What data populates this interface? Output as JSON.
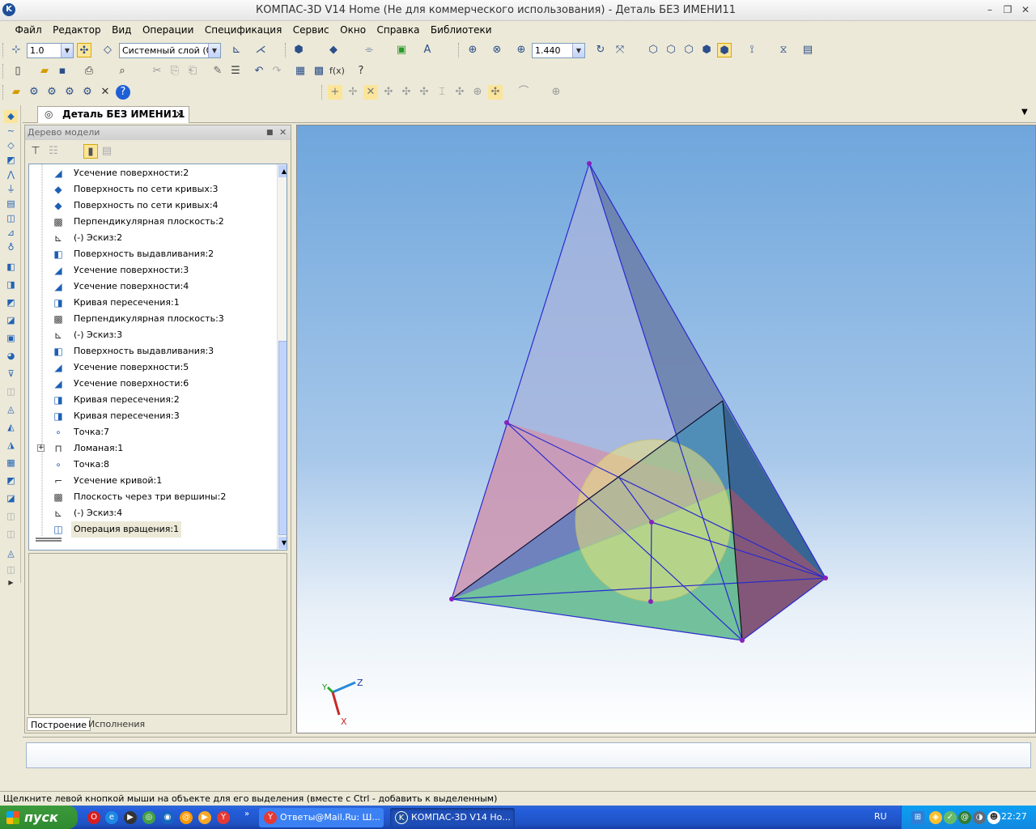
{
  "window": {
    "title": "КОМПАС-3D V14 Home (Не для коммерческого использования) - Деталь БЕЗ ИМЕНИ11",
    "app_icon": "kompas-logo-icon",
    "minimize": "–",
    "restore": "❐",
    "close": "✕"
  },
  "menu": [
    "Файл",
    "Редактор",
    "Вид",
    "Операции",
    "Спецификация",
    "Сервис",
    "Окно",
    "Справка",
    "Библиотеки"
  ],
  "toolbar1": {
    "step_value": "1.0",
    "layer_value": "Системный слой (0)",
    "zoom_value": "1.440"
  },
  "document_tab": {
    "label": "Деталь БЕЗ ИМЕНИ11",
    "close": "✕"
  },
  "tree": {
    "title": "Дерево модели",
    "pin": "■",
    "close": "✕",
    "items": [
      {
        "label": "Усечение поверхности:2",
        "icon": "surface-trim-icon"
      },
      {
        "label": "Поверхность по сети кривых:3",
        "icon": "curve-mesh-surface-icon"
      },
      {
        "label": "Поверхность по сети кривых:4",
        "icon": "curve-mesh-surface-icon"
      },
      {
        "label": "Перпендикулярная плоскость:2",
        "icon": "plane-icon"
      },
      {
        "label": "(-) Эскиз:2",
        "icon": "sketch-icon"
      },
      {
        "label": "Поверхность выдавливания:2",
        "icon": "extrude-surface-icon"
      },
      {
        "label": "Усечение поверхности:3",
        "icon": "surface-trim-icon"
      },
      {
        "label": "Усечение поверхности:4",
        "icon": "surface-trim-icon"
      },
      {
        "label": "Кривая пересечения:1",
        "icon": "intersection-curve-icon"
      },
      {
        "label": "Перпендикулярная плоскость:3",
        "icon": "plane-icon"
      },
      {
        "label": "(-) Эскиз:3",
        "icon": "sketch-icon"
      },
      {
        "label": "Поверхность выдавливания:3",
        "icon": "extrude-surface-icon"
      },
      {
        "label": "Усечение поверхности:5",
        "icon": "surface-trim-icon"
      },
      {
        "label": "Усечение поверхности:6",
        "icon": "surface-trim-icon"
      },
      {
        "label": "Кривая пересечения:2",
        "icon": "intersection-curve-icon"
      },
      {
        "label": "Кривая пересечения:3",
        "icon": "intersection-curve-icon"
      },
      {
        "label": "Точка:7",
        "icon": "point-icon"
      },
      {
        "label": "Ломаная:1",
        "icon": "polyline-icon"
      },
      {
        "label": "Точка:8",
        "icon": "point-icon"
      },
      {
        "label": "Усечение кривой:1",
        "icon": "curve-trim-icon"
      },
      {
        "label": "Плоскость через три вершины:2",
        "icon": "plane-icon"
      },
      {
        "label": "(-) Эскиз:4",
        "icon": "sketch-icon"
      },
      {
        "label": "Операция вращения:1",
        "icon": "revolve-icon"
      }
    ],
    "tabs": [
      "Построение",
      "Исполнения"
    ]
  },
  "axes": {
    "x": "X",
    "y": "Y",
    "z": "Z"
  },
  "status_text": "Щелкните левой кнопкой мыши на объекте для его выделения (вместе с Ctrl - добавить к выделенным)",
  "taskbar": {
    "start_label": "пуск",
    "tasks": [
      {
        "label": "Ответы@Mail.Ru: Ш...",
        "icon": "yandex-browser-icon"
      },
      {
        "label": "КОМПАС-3D V14 Но...",
        "icon": "kompas-logo-icon"
      }
    ],
    "language": "RU",
    "clock": "22:27"
  },
  "colors": {
    "viewport_top": "#6fa6dc",
    "pyramid_edge": "#2a2acf",
    "vertex": "#8a1fbf",
    "sphere": "#e6e07a"
  }
}
